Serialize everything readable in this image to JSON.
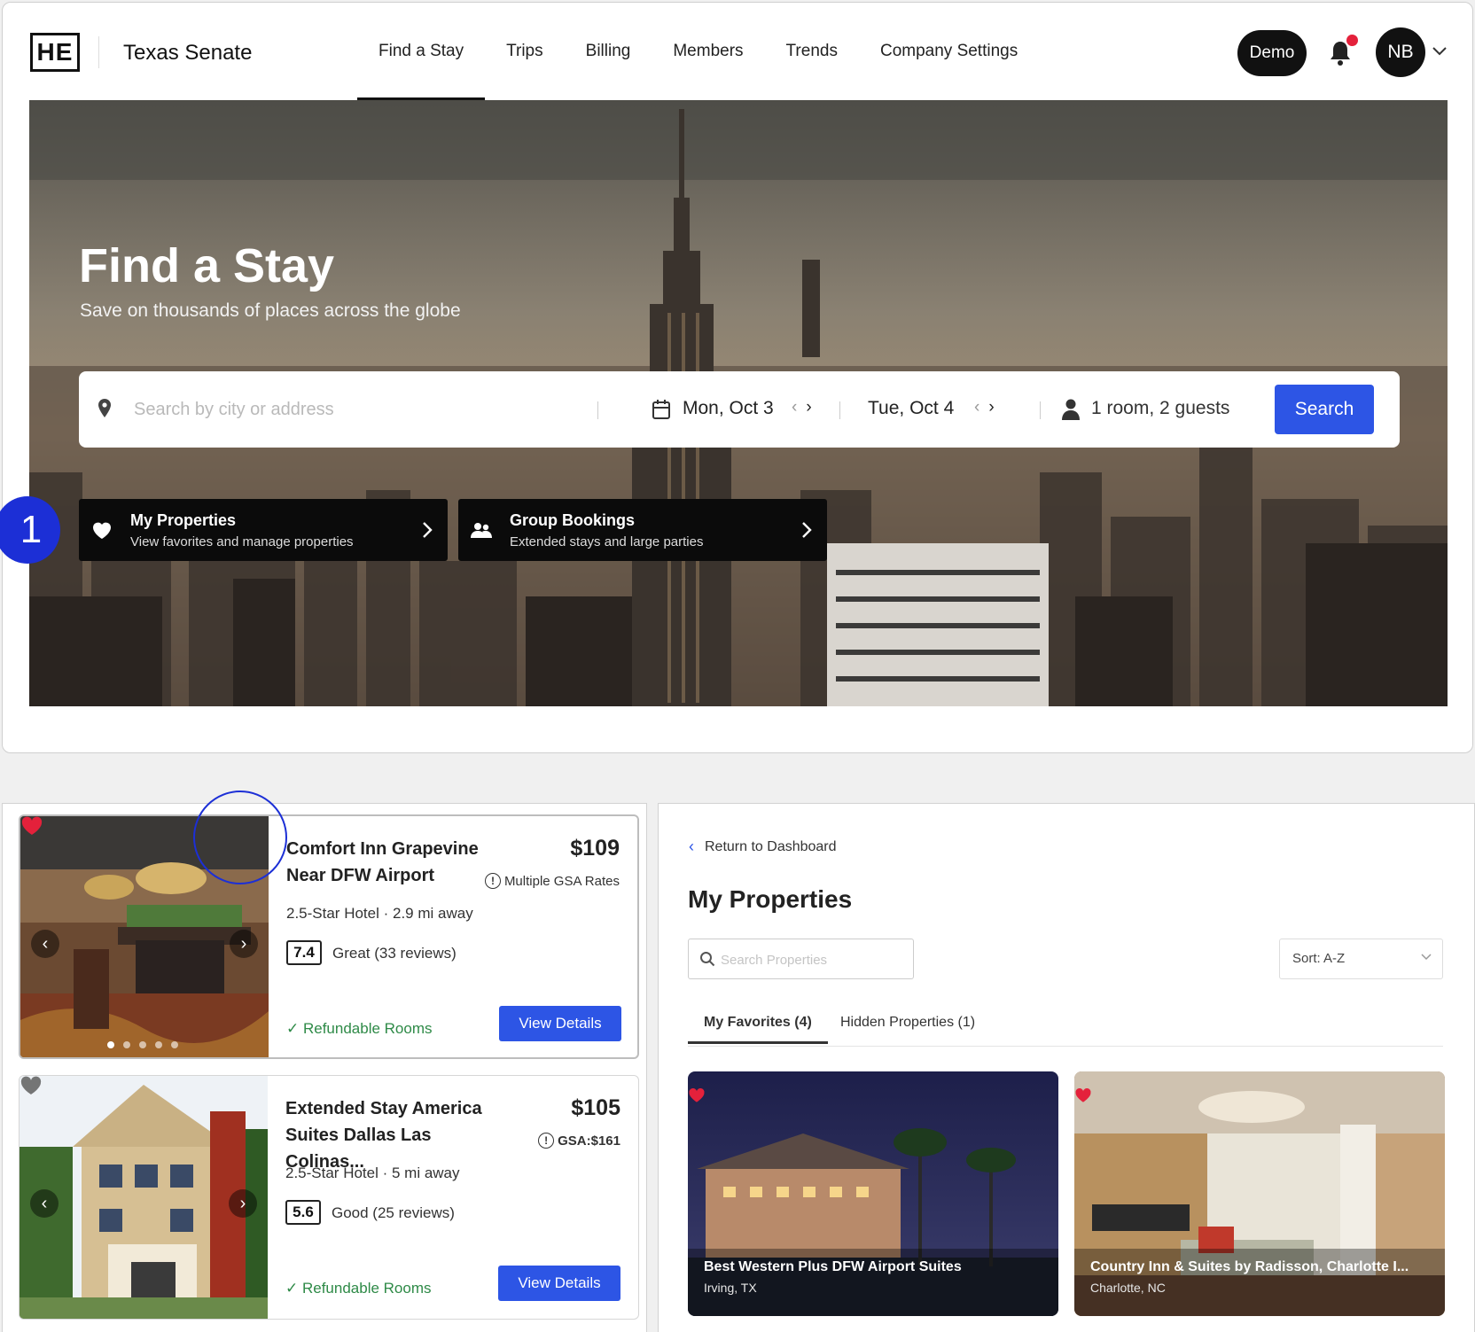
{
  "header": {
    "logo": "HE",
    "company": "Texas Senate",
    "nav": [
      "Find a Stay",
      "Trips",
      "Billing",
      "Members",
      "Trends",
      "Company Settings"
    ],
    "demo": "Demo",
    "avatar": "NB"
  },
  "hero": {
    "title": "Find a Stay",
    "subtitle": "Save on thousands of places across the globe"
  },
  "search": {
    "placeholder": "Search by city or address",
    "checkin": "Mon, Oct 3",
    "checkout": "Tue, Oct 4",
    "guests": "1 room, 2 guests",
    "button": "Search"
  },
  "quick_links": [
    {
      "title": "My Properties",
      "subtitle": "View favorites and manage properties"
    },
    {
      "title": "Group Bookings",
      "subtitle": "Extended stays and large parties"
    }
  ],
  "step_badge": "1",
  "hotels": [
    {
      "name": "Comfort Inn Grapevine Near DFW Airport",
      "price": "$109",
      "gsa": "Multiple GSA Rates",
      "meta": "2.5-Star Hotel · 2.9 mi away",
      "score": "7.4",
      "rating": "Great (33 reviews)",
      "refund": "Refundable Rooms",
      "button": "View Details",
      "favorited": true
    },
    {
      "name": "Extended Stay America Suites Dallas Las Colinas...",
      "price": "$105",
      "gsa": "GSA:$161",
      "meta": "2.5-Star Hotel · 5 mi away",
      "score": "5.6",
      "rating": "Good (25 reviews)",
      "refund": "Refundable Rooms",
      "button": "View Details",
      "favorited": false
    }
  ],
  "my_properties": {
    "back": "Return to Dashboard",
    "title": "My Properties",
    "search_placeholder": "Search Properties",
    "sort": "Sort: A-Z",
    "tabs": [
      "My Favorites (4)",
      "Hidden Properties (1)"
    ],
    "favorites": [
      {
        "name": "Best Western Plus DFW Airport Suites",
        "location": "Irving, TX"
      },
      {
        "name": "Country Inn & Suites by Radisson, Charlotte I...",
        "location": "Charlotte, NC"
      }
    ]
  },
  "colors": {
    "accent": "#2d55e5",
    "highlight": "#1c2fd6",
    "heart": "#e4213b",
    "refund": "#2e8a47"
  }
}
